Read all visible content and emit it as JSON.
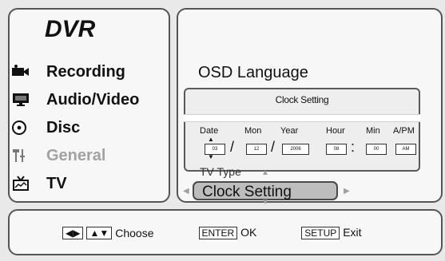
{
  "menu": {
    "title": "DVR",
    "items": [
      {
        "label": "Recording",
        "icon": "camcorder-icon"
      },
      {
        "label": "Audio/Video",
        "icon": "monitor-icon"
      },
      {
        "label": "Disc",
        "icon": "disc-icon"
      },
      {
        "label": "General",
        "icon": "general-settings-icon"
      },
      {
        "label": "TV",
        "icon": "tv-icon"
      }
    ]
  },
  "right": {
    "osd_language_label": "OSD Language",
    "tv_type_label": "TV Type",
    "selected_item_label": "Clock Setting"
  },
  "clock_dialog": {
    "title": "Clock Setting",
    "headers": [
      "Date",
      "Mon",
      "Year",
      "Hour",
      "Min",
      "A/PM"
    ],
    "values": {
      "date": "03",
      "mon": "12",
      "year": "2006",
      "hour": "08",
      "min": "00",
      "ampm": "AM"
    }
  },
  "footer": {
    "choose": "Choose",
    "enter_key": "ENTER",
    "ok": "OK",
    "setup_key": "SETUP",
    "exit": "Exit"
  },
  "colors": {
    "background": "#e9e9e9",
    "panel": "#f7f7f7",
    "border": "#555555",
    "selected_fill": "#bdbdbd",
    "disabled_text": "#a2a2a2"
  }
}
